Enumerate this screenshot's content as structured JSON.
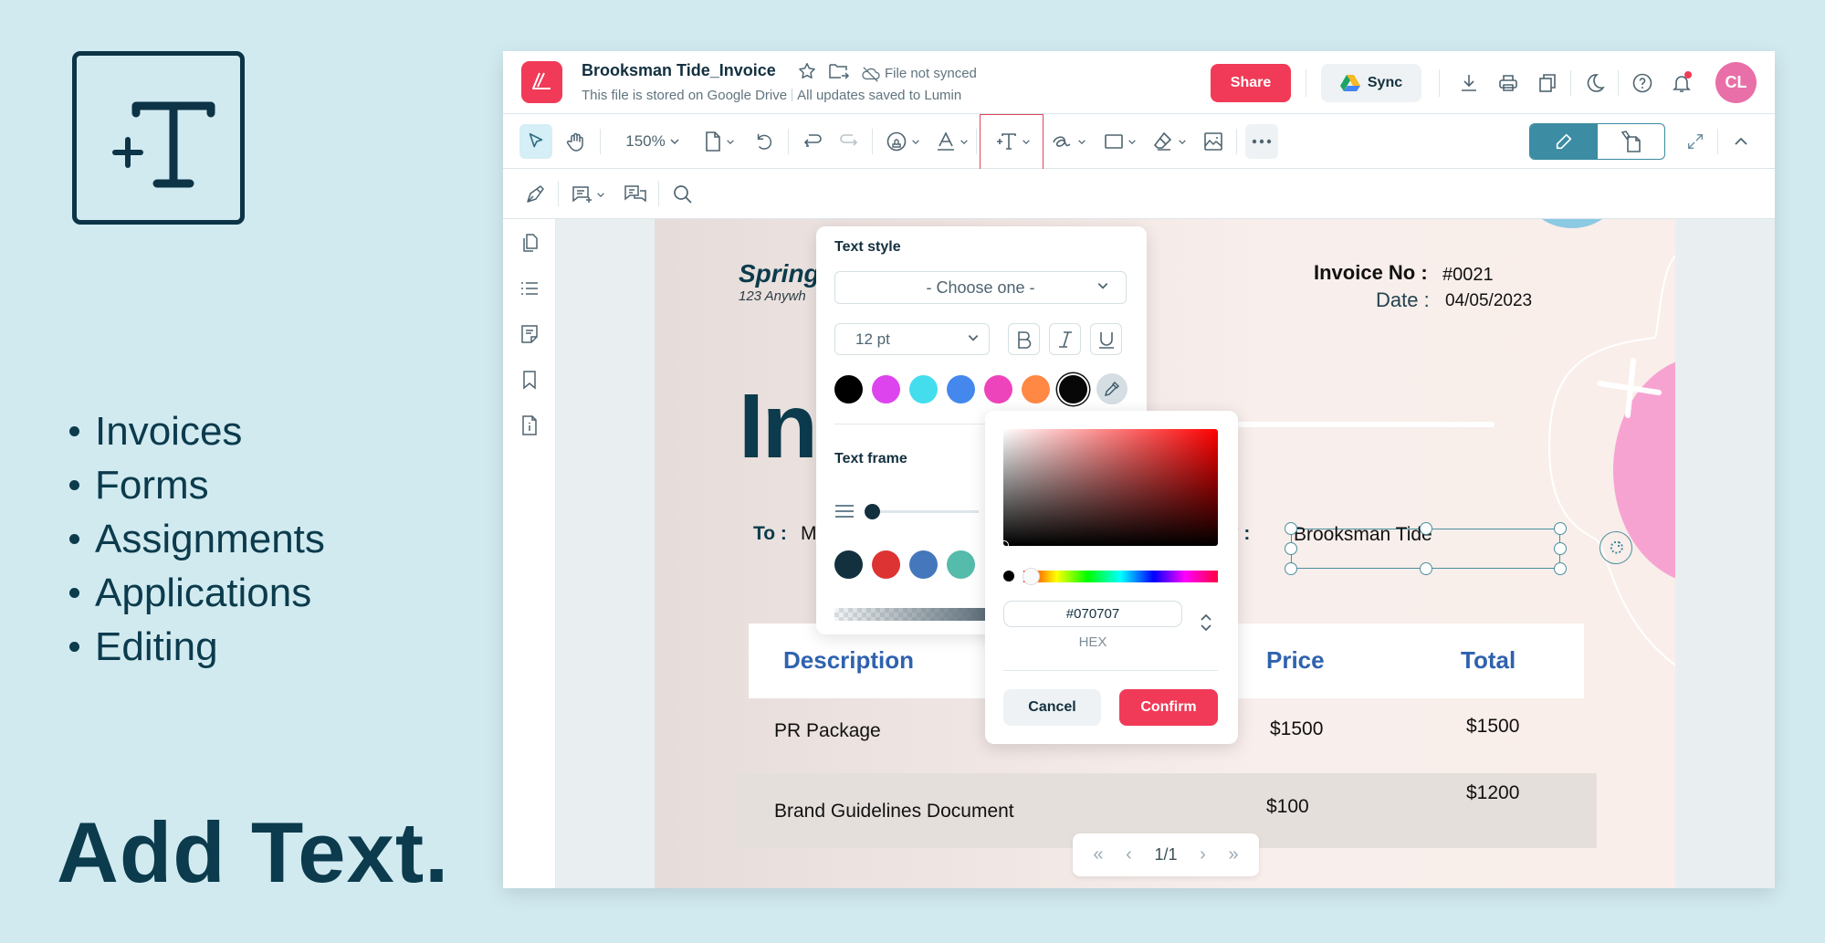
{
  "promo": {
    "icon": "add-text-icon",
    "features": [
      "Invoices",
      "Forms",
      "Assignments",
      "Applications",
      "Editing"
    ],
    "headline": "Add Text."
  },
  "header": {
    "logo": "lumin-logo",
    "doc_title": "Brooksman Tide_Invoice",
    "storage_note": "This file is stored on Google Drive",
    "save_status": "All updates saved to Lumin",
    "sync_status": "File not synced",
    "share_label": "Share",
    "sync_label": "Sync",
    "avatar_initials": "CL",
    "icons": [
      "star-icon",
      "move-folder-icon",
      "cloud-off-icon",
      "download-icon",
      "print-icon",
      "copy-icon",
      "dark-mode-icon",
      "help-icon",
      "bell-icon"
    ]
  },
  "toolbar": {
    "zoom_level": "150%",
    "tools": [
      "select",
      "pan",
      "zoom",
      "page",
      "rotate",
      "undo",
      "redo",
      "stamp",
      "text-color",
      "add-text",
      "signature",
      "shape",
      "eraser",
      "image",
      "more"
    ],
    "active_tool": "add-text",
    "mode_toggle": [
      "edit",
      "edit-document"
    ],
    "active_mode": "edit"
  },
  "toolbar2": {
    "tools": [
      "sign",
      "add-comment",
      "comments",
      "search"
    ]
  },
  "sidebar": {
    "items": [
      "pages",
      "outline",
      "notes",
      "bookmarks",
      "file-info"
    ]
  },
  "document": {
    "company": "Spring",
    "address": "123 Anywh",
    "title_fragment": "In",
    "invoice_no_label": "Invoice No :",
    "invoice_no": "#0021",
    "date_label": "Date :",
    "date": "04/05/2023",
    "to_label": "To :",
    "to_value": "M",
    "company_label": "ny :",
    "company_value": "Brooksman Tide",
    "table": {
      "headers": [
        "Description",
        "Price",
        "Total"
      ],
      "rows": [
        {
          "description": "PR Package",
          "price": "$1500",
          "total": "$1500"
        },
        {
          "description": "Brand Guidelines Document",
          "price": "$100",
          "total": "$1200"
        }
      ]
    }
  },
  "pager": {
    "current": "1/1"
  },
  "text_style_panel": {
    "heading": "Text style",
    "style_placeholder": "- Choose one -",
    "font_size": "12 pt",
    "format_buttons": [
      "B",
      "I",
      "U"
    ],
    "colors": [
      "#000000",
      "#dd44ee",
      "#44ddee",
      "#4488ee",
      "#ee44bb",
      "#ff8844",
      "#070707"
    ],
    "selected_color": "#070707",
    "frame_heading": "Text frame",
    "frame_colors": [
      "#13303f",
      "#dd3333",
      "#4477bb",
      "#55bbaa"
    ]
  },
  "color_picker": {
    "hex_value": "#070707",
    "mode_label": "HEX",
    "cancel_label": "Cancel",
    "confirm_label": "Confirm"
  }
}
